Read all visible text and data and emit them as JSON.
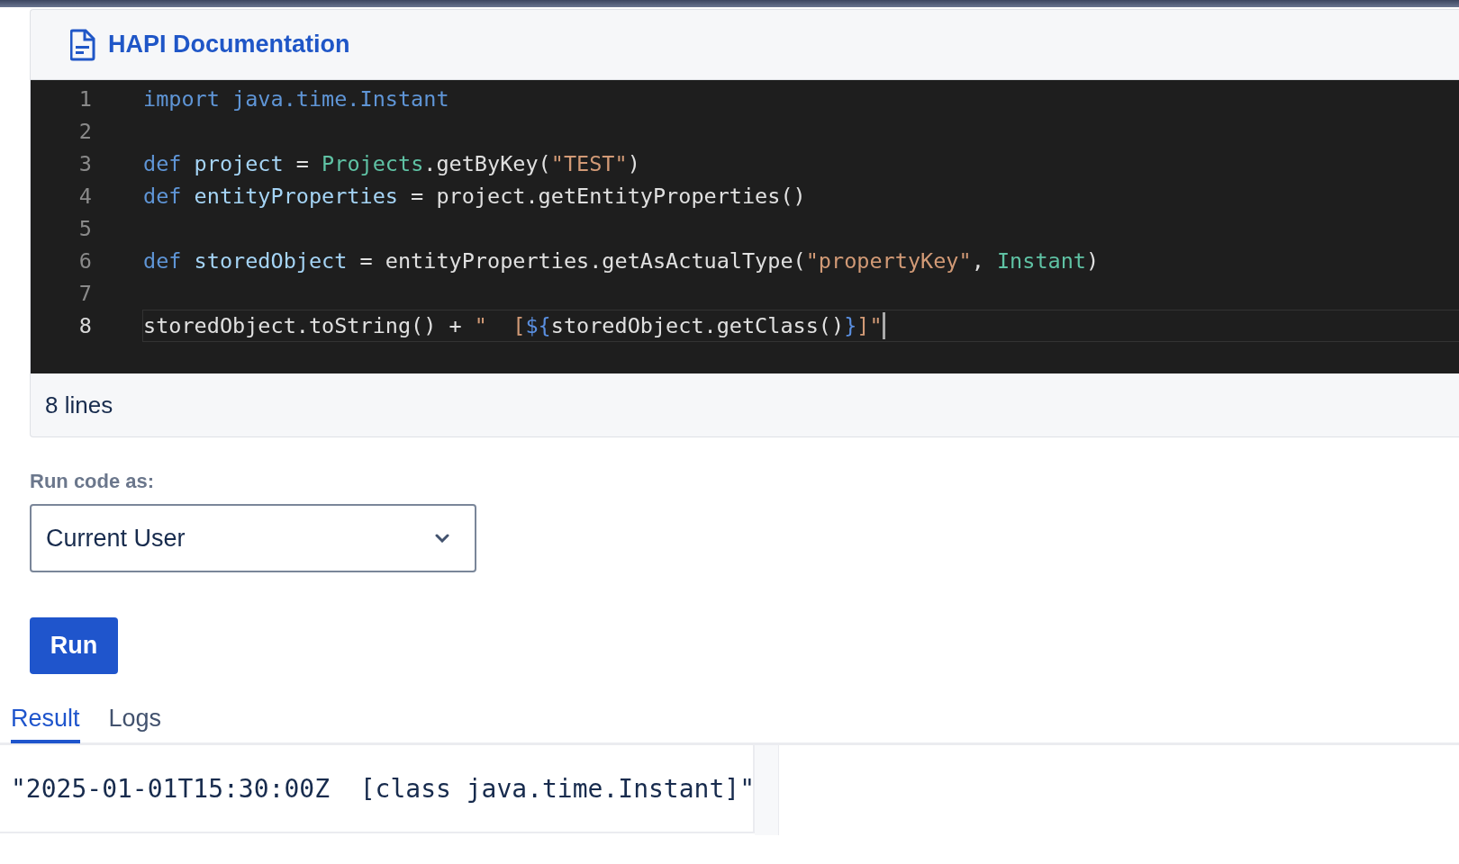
{
  "header": {
    "title": "HAPI Documentation"
  },
  "editor": {
    "lines": [
      {
        "number": "1",
        "current": false,
        "tokens": [
          {
            "text": "import java.time.Instant",
            "kind": "keyword"
          }
        ]
      },
      {
        "number": "2",
        "current": false
      },
      {
        "number": "3",
        "current": false,
        "tokens": [
          {
            "text": "def ",
            "kind": "keyword"
          },
          {
            "text": "project",
            "kind": "variable"
          },
          {
            "text": " = ",
            "kind": "plain"
          },
          {
            "text": "Projects",
            "kind": "class"
          },
          {
            "text": ".getByKey(",
            "kind": "plain"
          },
          {
            "text": "\"TEST\"",
            "kind": "string"
          },
          {
            "text": ")",
            "kind": "plain"
          }
        ]
      },
      {
        "number": "4",
        "current": false,
        "tokens": [
          {
            "text": "def ",
            "kind": "keyword"
          },
          {
            "text": "entityProperties",
            "kind": "variable"
          },
          {
            "text": " = project.getEntityProperties()",
            "kind": "plain"
          }
        ]
      },
      {
        "number": "5",
        "current": false
      },
      {
        "number": "6",
        "current": false,
        "tokens": [
          {
            "text": "def ",
            "kind": "keyword"
          },
          {
            "text": "storedObject",
            "kind": "variable"
          },
          {
            "text": " = entityProperties.getAsActualType(",
            "kind": "plain"
          },
          {
            "text": "\"propertyKey\"",
            "kind": "string"
          },
          {
            "text": ", ",
            "kind": "plain"
          },
          {
            "text": "Instant",
            "kind": "class"
          },
          {
            "text": ")",
            "kind": "plain"
          }
        ]
      },
      {
        "number": "7",
        "current": false
      },
      {
        "number": "8",
        "current": true,
        "tokens": [
          {
            "text": "storedObject.toString() + ",
            "kind": "plain"
          },
          {
            "text": "\"  [",
            "kind": "string"
          },
          {
            "text": "${",
            "kind": "brace"
          },
          {
            "text": "storedObject.getClass()",
            "kind": "plain"
          },
          {
            "text": "}",
            "kind": "brace"
          },
          {
            "text": "]\"",
            "kind": "string"
          }
        ]
      }
    ],
    "footer": "8 lines"
  },
  "run_as": {
    "label": "Run code as:",
    "value": "Current User"
  },
  "run_button": "Run",
  "tabs": [
    {
      "label": "Result",
      "selected": true
    },
    {
      "label": "Logs",
      "selected": false
    }
  ],
  "result": "\"2025-01-01T15:30:00Z  [class java.time.Instant]\""
}
